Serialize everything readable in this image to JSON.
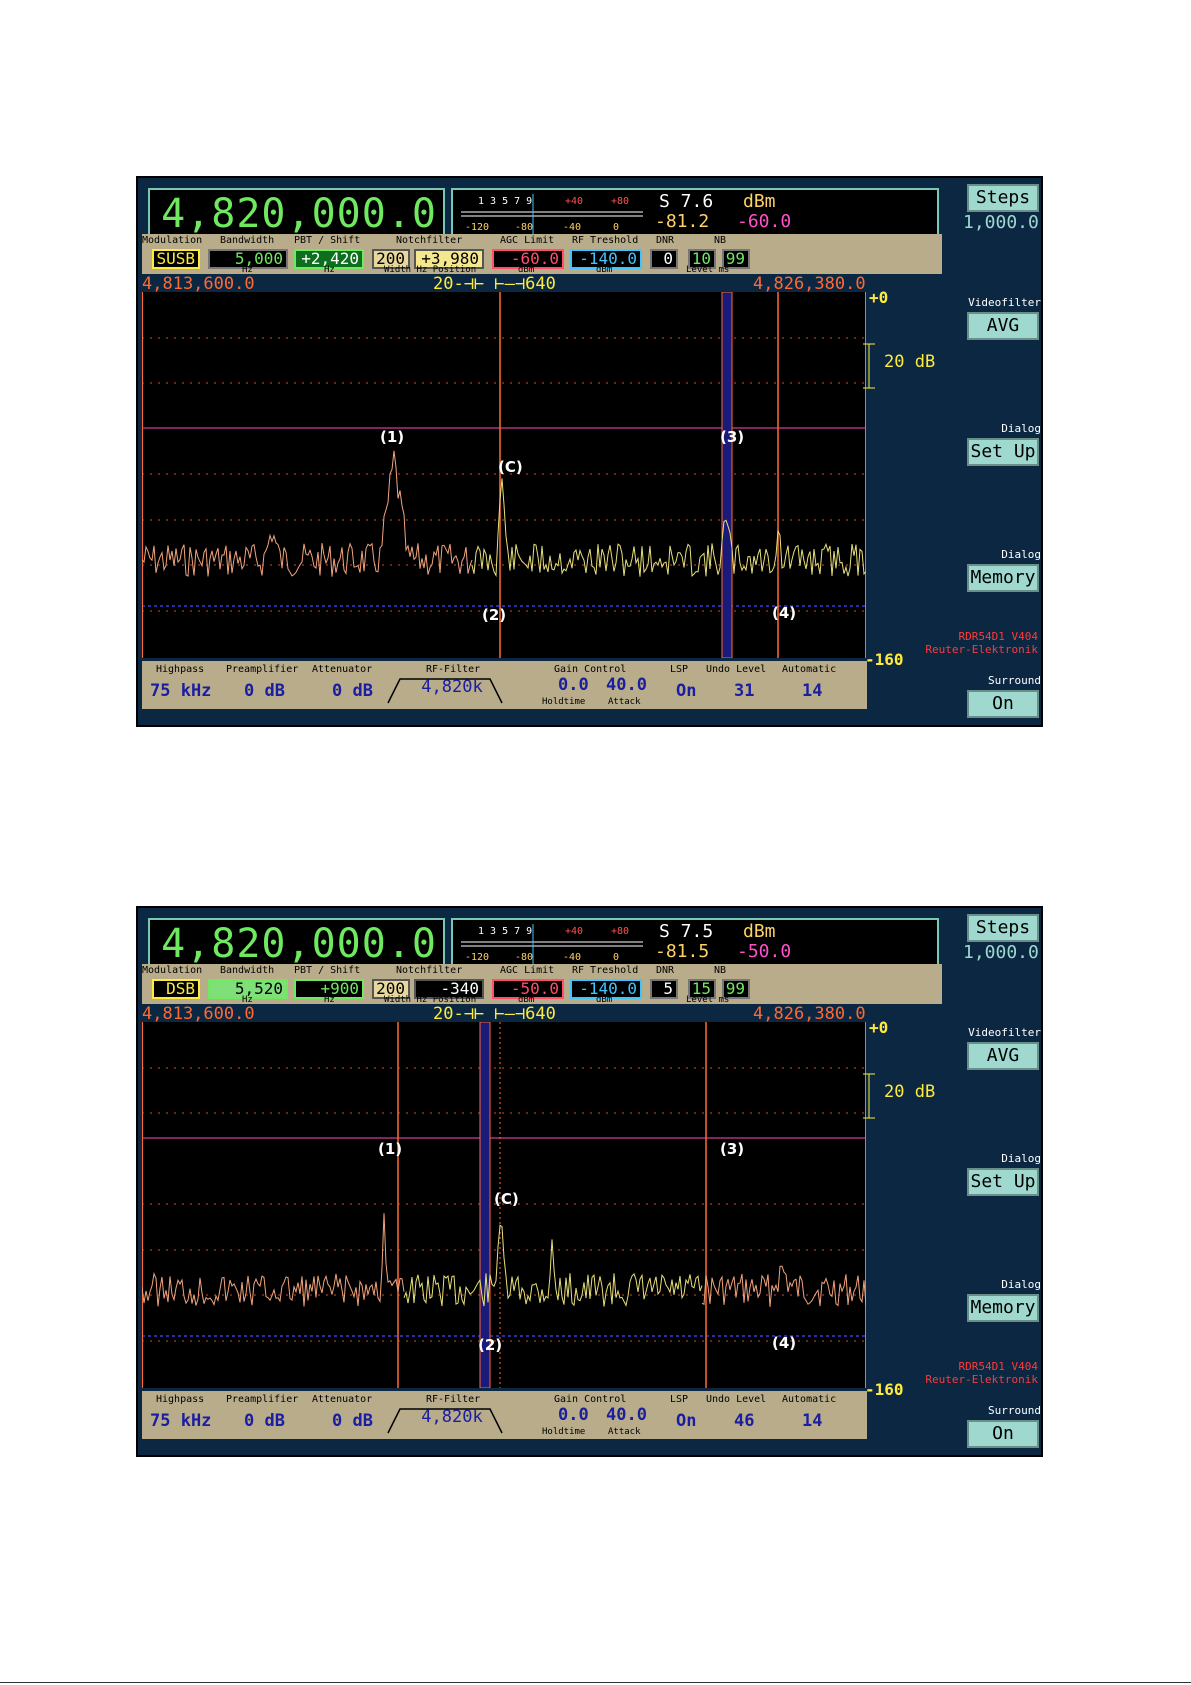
{
  "common": {
    "freq_left": "4,813,600.0",
    "freq_right": "4,826,380.0",
    "span_a": "20",
    "span_b": "640",
    "db_top": "+0",
    "db_bottom": "-160",
    "db_step": "20 dB",
    "version_line1": "RDR54D1 V404",
    "version_line2": "Reuter-Elektronik",
    "meter_scale_top": "1 3 5 7 9",
    "meter_plus40": "+40",
    "meter_plus80": "+80",
    "meter_m120": "-120",
    "meter_m80": "-80",
    "meter_m40": "-40",
    "meter_0": "0",
    "dbm_label": "dBm",
    "labels": {
      "modulation": "Modulation",
      "bandwidth": "Bandwidth",
      "pbt": "PBT / Shift",
      "notch": "Notchfilter",
      "agc": "AGC Limit",
      "rft": "RF Treshold",
      "dnr": "DNR",
      "nb": "NB",
      "hz1": "Hz",
      "hz2": "Hz",
      "width_hz_position": "Width Hz Position",
      "dbm1": "dBm",
      "dbm2": "dBm",
      "level_ms": "Level  ms",
      "highpass": "Highpass",
      "preamp": "Preamplifier",
      "atten": "Attenuator",
      "rffilter": "RF-Filter",
      "gain": "Gain Control",
      "holdtime": "Holdtime",
      "attack": "Attack",
      "lsp": "LSP",
      "undo": "Undo Level",
      "automatic": "Automatic"
    },
    "buttons": {
      "steps": "Steps",
      "videofilter_label": "Videofilter",
      "avg": "AVG",
      "dialog_label1": "Dialog",
      "setup": "Set Up",
      "dialog_label2": "Dialog",
      "memory": "Memory",
      "surround_label": "Surround",
      "on": "On"
    },
    "bottom_values": {
      "highpass": "75 kHz",
      "preamp": "0 dB",
      "atten": "0 dB",
      "rffilter": "4,820k",
      "holdtime": "0.0",
      "attack": "40.0",
      "lsp": "On",
      "automatic": "14"
    },
    "markers": {
      "m1": "(1)",
      "m2": "(2)",
      "m3": "(3)",
      "m4": "(4)",
      "mc": "(C)"
    },
    "colors": {
      "freq": "#6fe95f",
      "orange": "#ff6a32",
      "yellow": "#ffeb3b",
      "teal": "#9ed8cf"
    }
  },
  "screens": [
    {
      "frequency": "4,820,000.0",
      "s_value": "S 7.6",
      "level_dbm": "-81.2",
      "level_limit": "-60.0",
      "modulation": "SUSB",
      "bandwidth": "5,000",
      "pbt": "+2,420",
      "notch_width": "200",
      "notch_pos": "+3,980",
      "agc": "-60.0",
      "rft": "-140.0",
      "dnr": "0",
      "nb_level": "10",
      "nb_ms": "99",
      "steps": "1,000.0",
      "undo": "31"
    },
    {
      "frequency": "4,820,000.0",
      "s_value": "S 7.5",
      "level_dbm": "-81.5",
      "level_limit": "-50.0",
      "modulation": "DSB",
      "bandwidth": "5,520",
      "pbt": "+900",
      "notch_width": "200",
      "notch_pos": "-340",
      "agc": "-50.0",
      "rft": "-140.0",
      "dnr": "5",
      "nb_level": "15",
      "nb_ms": "99",
      "steps": "1,000.0",
      "undo": "46"
    }
  ]
}
